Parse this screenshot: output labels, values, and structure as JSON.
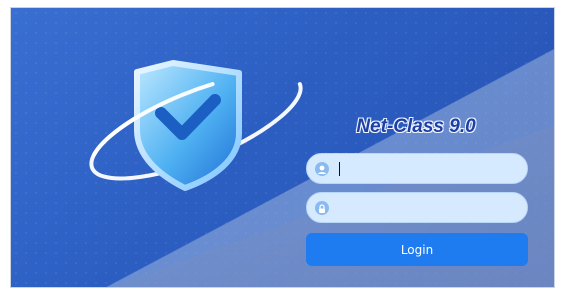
{
  "app": {
    "title": "Net-Class 9.0"
  },
  "login_form": {
    "username_value": "",
    "password_value": "",
    "login_label": "Login",
    "username_icon": "user-icon",
    "password_icon": "lock-icon"
  },
  "graphics": {
    "emblem": "shield-check-icon",
    "accent_color": "#1f7bf0",
    "background_color": "#2c5ec2"
  }
}
